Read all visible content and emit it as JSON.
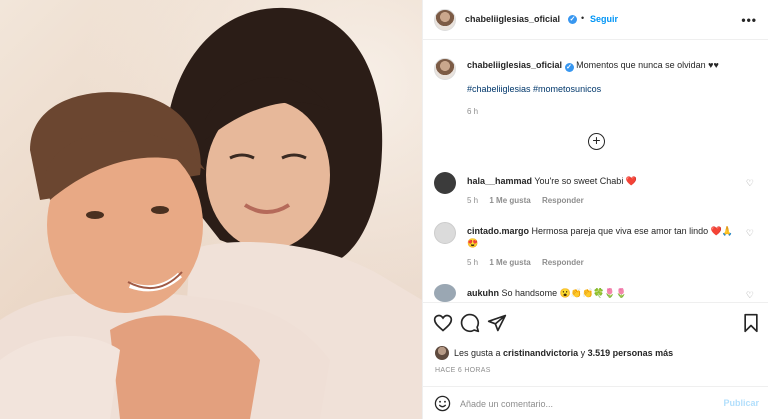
{
  "post": {
    "author": "chabeliiglesias_oficial",
    "follow_label": "Seguir",
    "separator": "•",
    "more": "•••"
  },
  "caption": {
    "username": "chabeliiglesias_oficial",
    "text": "Momentos que nunca se olvidan ♥♥",
    "hashtags": "#chabeliiglesias #mometosunicos",
    "time": "6 h"
  },
  "comments": [
    {
      "username": "hala__hammad",
      "text": "You're so sweet Chabi ❤️",
      "time": "5 h",
      "likes": "1 Me gusta",
      "reply": "Responder",
      "avatar_color": "#3b3b3b"
    },
    {
      "username": "cintado.margo",
      "text": "Hermosa pareja que viva ese amor tan lindo ❤️🙏😍",
      "time": "5 h",
      "likes": "1 Me gusta",
      "reply": "Responder",
      "avatar_color": "#dbdbdb"
    },
    {
      "username": "aukuhn",
      "text": "So handsome 😮👏👏🍀🌷🌷",
      "avatar_color": "#9aa7b3"
    }
  ],
  "likes": {
    "prefix": "Les gusta a ",
    "user": "cristinandvictoria",
    "mid": " y ",
    "count": "3.519 personas más"
  },
  "timestamp": "HACE 6 HORAS",
  "add_comment": {
    "placeholder": "Añade un comentario...",
    "publish": "Publicar"
  },
  "icons": {
    "like": "heart-icon",
    "comment": "comment-icon",
    "share": "share-icon",
    "save": "bookmark-icon",
    "emoji": "emoji-icon",
    "load_more": "plus-circle-icon",
    "verified": "verified-badge-icon"
  },
  "colors": {
    "accent": "#0095f6",
    "hashtag": "#00376b",
    "muted": "#8e8e8e",
    "publish_disabled": "#b2dffc"
  }
}
